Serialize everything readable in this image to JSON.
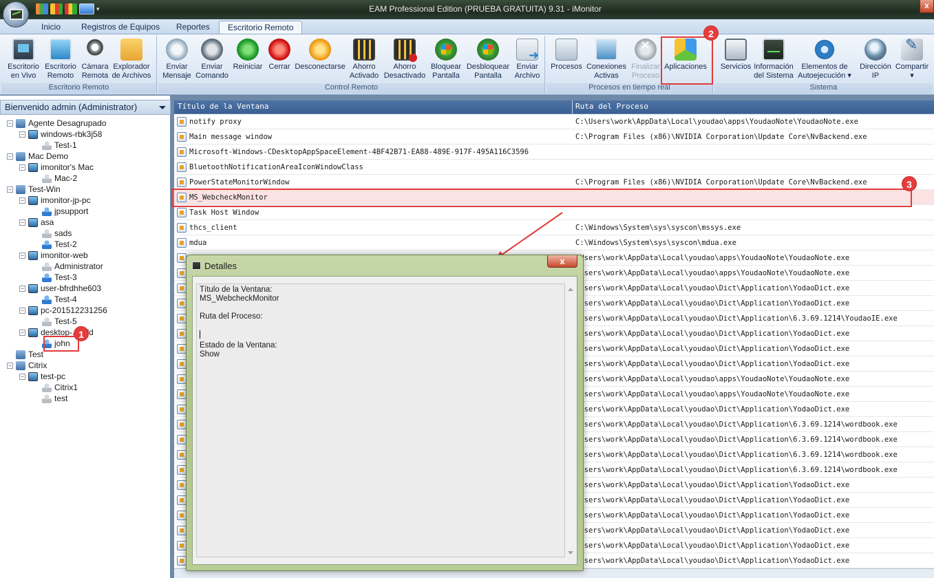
{
  "window": {
    "title": "EAM Professional Edition (PRUEBA GRATUITA) 9.31 - iMonitor",
    "close_glyph": "x"
  },
  "tabs": [
    {
      "label": "Inicio",
      "active": false
    },
    {
      "label": "Registros de Equipos",
      "active": false
    },
    {
      "label": "Reportes",
      "active": false
    },
    {
      "label": "Escritorio Remoto",
      "active": true
    }
  ],
  "ribbon": {
    "groups": [
      {
        "label": "Escritorio Remoto",
        "buttons": [
          {
            "l1": "Escritorio",
            "l2": "en Vivo",
            "icon": "monitor-icon"
          },
          {
            "l1": "Escritorio",
            "l2": "Remoto",
            "icon": "screen-icon"
          },
          {
            "l1": "Cámara",
            "l2": "Remota",
            "icon": "webcam-icon"
          },
          {
            "l1": "Explorador",
            "l2": "de Archivos",
            "icon": "folder-search-icon"
          }
        ]
      },
      {
        "label": "Control Remoto",
        "buttons": [
          {
            "l1": "Enviar",
            "l2": "Mensaje",
            "icon": "message-icon"
          },
          {
            "l1": "Enviar",
            "l2": "Comando",
            "icon": "command-icon"
          },
          {
            "l1": "Reiniciar",
            "l2": "",
            "icon": "restart-icon"
          },
          {
            "l1": "Cerrar",
            "l2": "",
            "icon": "power-icon"
          },
          {
            "l1": "Desconectarse",
            "l2": "",
            "icon": "key-icon"
          },
          {
            "l1": "Ahorro",
            "l2": "Activado",
            "icon": "screensaver-on-icon"
          },
          {
            "l1": "Ahorro",
            "l2": "Desactivado",
            "icon": "screensaver-off-icon"
          },
          {
            "l1": "Bloquear",
            "l2": "Pantalla",
            "icon": "lock-screen-icon"
          },
          {
            "l1": "Desbloquear",
            "l2": "Pantalla",
            "icon": "unlock-screen-icon"
          },
          {
            "l1": "Enviar",
            "l2": "Archivo",
            "icon": "send-file-icon"
          }
        ]
      },
      {
        "label": "Procesos en tiempo real",
        "buttons": [
          {
            "l1": "Procesos",
            "l2": "",
            "icon": "processes-icon"
          },
          {
            "l1": "Conexiones",
            "l2": "Activas",
            "icon": "connections-icon"
          },
          {
            "l1": "Finalizar",
            "l2": "Proceso",
            "icon": "end-process-icon",
            "disabled": true
          },
          {
            "l1": "Aplicaciones",
            "l2": "",
            "icon": "applications-icon"
          }
        ]
      },
      {
        "label": "Sistema",
        "buttons": [
          {
            "l1": "Servicios",
            "l2": "",
            "icon": "services-icon"
          },
          {
            "l1": "Información",
            "l2": "del Sistema",
            "icon": "system-info-icon"
          },
          {
            "l1": "Elementos de",
            "l2": "Autoejecución ▾",
            "icon": "gear-icon"
          },
          {
            "l1": "Dirección",
            "l2": "IP",
            "icon": "ip-icon"
          },
          {
            "l1": "Compartir",
            "l2": "▾",
            "icon": "share-icon"
          }
        ]
      }
    ]
  },
  "left_panel": {
    "header": "Bienvenido admin (Administrator)",
    "tree": [
      {
        "label": "Agente Desagrupado",
        "level": 0,
        "type": "group",
        "exp": "−"
      },
      {
        "label": "windows-rbk3j58",
        "level": 1,
        "type": "pc",
        "exp": "−"
      },
      {
        "label": "Test-1",
        "level": 2,
        "type": "user-off"
      },
      {
        "label": "Mac Demo",
        "level": 0,
        "type": "group",
        "exp": "−"
      },
      {
        "label": "imonitor's Mac",
        "level": 1,
        "type": "pc",
        "exp": "−"
      },
      {
        "label": "Mac-2",
        "level": 2,
        "type": "user-off"
      },
      {
        "label": "Test-Win",
        "level": 0,
        "type": "group",
        "exp": "−"
      },
      {
        "label": "imonitor-jp-pc",
        "level": 1,
        "type": "pc",
        "exp": "−"
      },
      {
        "label": "jpsupport",
        "level": 2,
        "type": "user-on"
      },
      {
        "label": "asa",
        "level": 1,
        "type": "pc",
        "exp": "−"
      },
      {
        "label": "sads",
        "level": 2,
        "type": "user-off"
      },
      {
        "label": "Test-2",
        "level": 2,
        "type": "user-on"
      },
      {
        "label": "imonitor-web",
        "level": 1,
        "type": "pc",
        "exp": "−"
      },
      {
        "label": "Administrator",
        "level": 2,
        "type": "user-off"
      },
      {
        "label": "Test-3",
        "level": 2,
        "type": "user-on"
      },
      {
        "label": "user-bfrdhhe603",
        "level": 1,
        "type": "pc",
        "exp": "−"
      },
      {
        "label": "Test-4",
        "level": 2,
        "type": "user-on"
      },
      {
        "label": "pc-201512231256",
        "level": 1,
        "type": "pc",
        "exp": "−"
      },
      {
        "label": "Test-5",
        "level": 2,
        "type": "user-off"
      },
      {
        "label": "desktop-...rpfd",
        "level": 1,
        "type": "pc",
        "exp": "−"
      },
      {
        "label": "john",
        "level": 2,
        "type": "user-on"
      },
      {
        "label": "Test",
        "level": 0,
        "type": "group",
        "exp": ""
      },
      {
        "label": "Citrix",
        "level": 0,
        "type": "group",
        "exp": "−"
      },
      {
        "label": "test-pc",
        "level": 1,
        "type": "pc",
        "exp": "−"
      },
      {
        "label": "Citrix1",
        "level": 2,
        "type": "user-off"
      },
      {
        "label": "test",
        "level": 2,
        "type": "user-off"
      }
    ]
  },
  "badges": {
    "one": "1",
    "two": "2",
    "three": "3"
  },
  "grid": {
    "columns": [
      "Título de la Ventana",
      "Ruta del Proceso"
    ],
    "rows": [
      {
        "title": "notify proxy",
        "path": "C:\\Users\\work\\AppData\\Local\\youdao\\apps\\YoudaoNote\\YoudaoNote.exe"
      },
      {
        "title": "Main message window",
        "path": "C:\\Program Files (x86)\\NVIDIA Corporation\\Update Core\\NvBackend.exe"
      },
      {
        "title": "Microsoft-Windows-CDesktopAppSpaceElement-4BF42B71-EA88-489E-917F-495A116C3596",
        "path": ""
      },
      {
        "title": "BluetoothNotificationAreaIconWindowClass",
        "path": ""
      },
      {
        "title": "PowerStateMonitorWindow",
        "path": "C:\\Program Files (x86)\\NVIDIA Corporation\\Update Core\\NvBackend.exe"
      },
      {
        "title": "MS_WebcheckMonitor",
        "path": "",
        "selected": true
      },
      {
        "title": "Task Host Window",
        "path": ""
      },
      {
        "title": "thcs_client",
        "path": "C:\\Windows\\System\\sys\\syscon\\mssys.exe"
      },
      {
        "title": "mdua",
        "path": "C:\\Windows\\System\\sys\\syscon\\mdua.exe"
      },
      {
        "title": "",
        "path": "\\Users\\work\\AppData\\Local\\youdao\\apps\\YoudaoNote\\YoudaoNote.exe"
      },
      {
        "title": "",
        "path": "\\Users\\work\\AppData\\Local\\youdao\\apps\\YoudaoNote\\YoudaoNote.exe"
      },
      {
        "title": "",
        "path": "\\Users\\work\\AppData\\Local\\youdao\\Dict\\Application\\YodaoDict.exe"
      },
      {
        "title": "",
        "path": "\\Users\\work\\AppData\\Local\\youdao\\Dict\\Application\\YodaoDict.exe"
      },
      {
        "title": "",
        "path": "\\Users\\work\\AppData\\Local\\youdao\\Dict\\Application\\6.3.69.1214\\YoudaoIE.exe"
      },
      {
        "title": "",
        "path": "\\Users\\work\\AppData\\Local\\youdao\\Dict\\Application\\YodaoDict.exe"
      },
      {
        "title": "",
        "path": "\\Users\\work\\AppData\\Local\\youdao\\Dict\\Application\\YodaoDict.exe"
      },
      {
        "title": "",
        "path": "\\Users\\work\\AppData\\Local\\youdao\\Dict\\Application\\YodaoDict.exe"
      },
      {
        "title": "",
        "path": "\\Users\\work\\AppData\\Local\\youdao\\apps\\YoudaoNote\\YoudaoNote.exe"
      },
      {
        "title": "",
        "path": "\\Users\\work\\AppData\\Local\\youdao\\apps\\YoudaoNote\\YoudaoNote.exe"
      },
      {
        "title": "",
        "path": "\\Users\\work\\AppData\\Local\\youdao\\Dict\\Application\\YodaoDict.exe"
      },
      {
        "title": "",
        "path": "\\Users\\work\\AppData\\Local\\youdao\\Dict\\Application\\6.3.69.1214\\wordbook.exe"
      },
      {
        "title": "",
        "path": "\\Users\\work\\AppData\\Local\\youdao\\Dict\\Application\\6.3.69.1214\\wordbook.exe"
      },
      {
        "title": "",
        "path": "\\Users\\work\\AppData\\Local\\youdao\\Dict\\Application\\6.3.69.1214\\wordbook.exe"
      },
      {
        "title": "",
        "path": "\\Users\\work\\AppData\\Local\\youdao\\Dict\\Application\\6.3.69.1214\\wordbook.exe"
      },
      {
        "title": "",
        "path": "\\Users\\work\\AppData\\Local\\youdao\\Dict\\Application\\YodaoDict.exe"
      },
      {
        "title": "",
        "path": "\\Users\\work\\AppData\\Local\\youdao\\Dict\\Application\\YodaoDict.exe"
      },
      {
        "title": "",
        "path": "\\Users\\work\\AppData\\Local\\youdao\\Dict\\Application\\YodaoDict.exe"
      },
      {
        "title": "",
        "path": "\\Users\\work\\AppData\\Local\\youdao\\Dict\\Application\\YodaoDict.exe"
      },
      {
        "title": "",
        "path": "\\Users\\work\\AppData\\Local\\youdao\\Dict\\Application\\YodaoDict.exe"
      },
      {
        "title": "",
        "path": "\\Users\\work\\AppData\\Local\\youdao\\Dict\\Application\\YodaoDict.exe"
      }
    ]
  },
  "dialog": {
    "title": "Detalles",
    "close_glyph": "x",
    "lines": [
      "Título de la Ventana:",
      "MS_WebcheckMonitor",
      "",
      "Ruta del Proceso:",
      "",
      "",
      "Estado de la Ventana:",
      "Show"
    ]
  }
}
